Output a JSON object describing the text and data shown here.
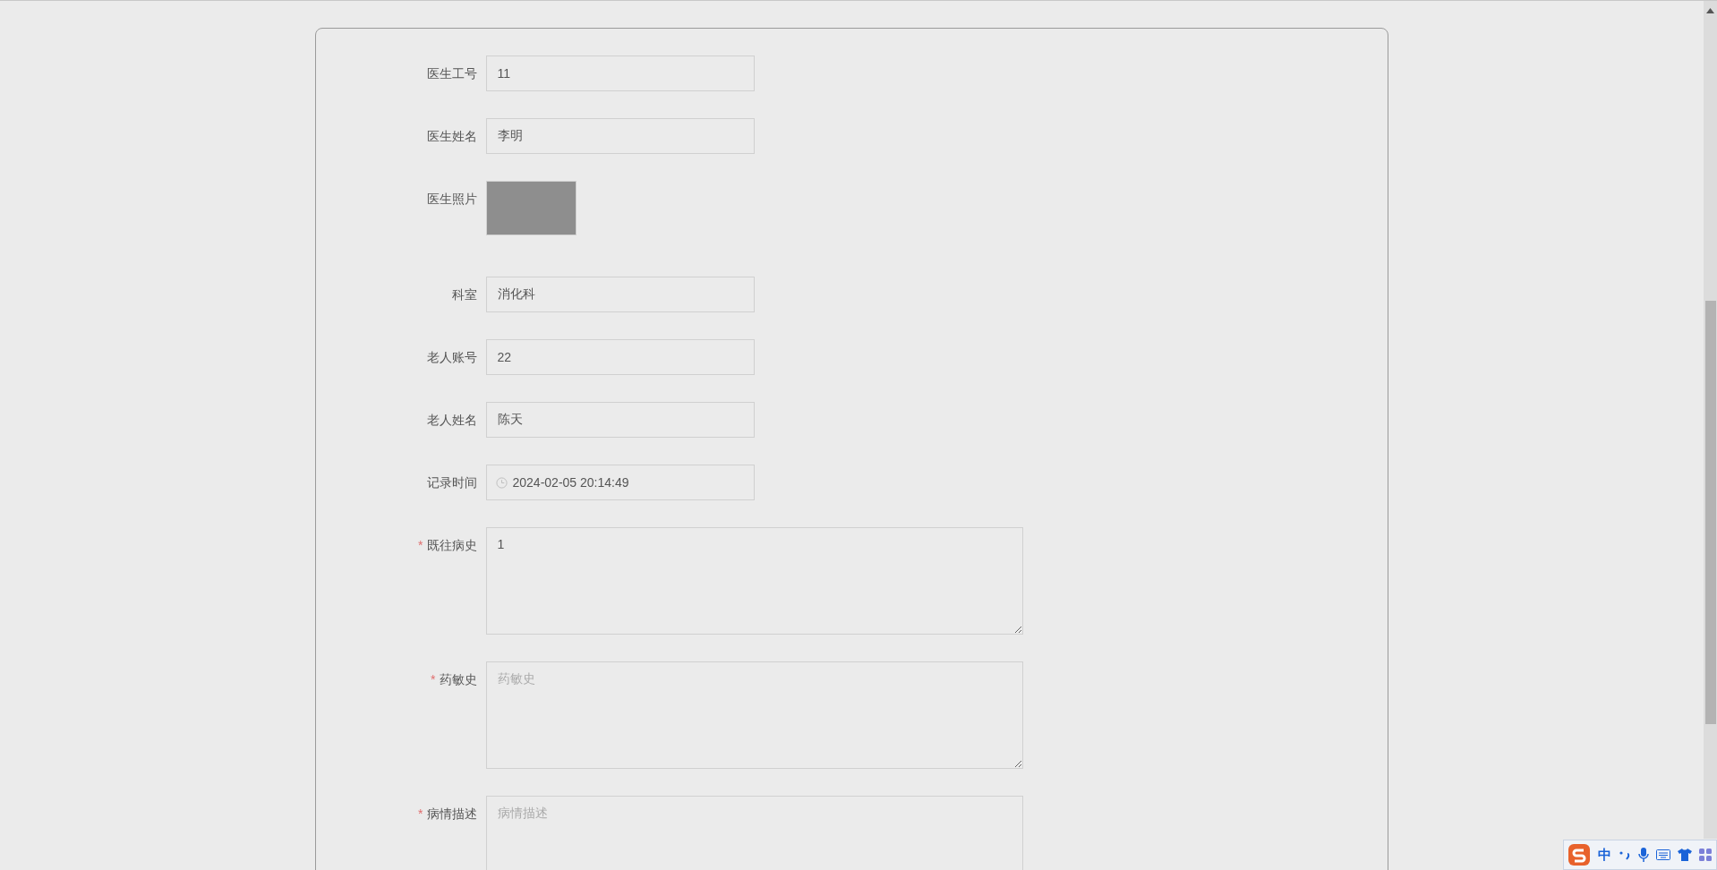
{
  "form": {
    "fields": [
      {
        "kind": "text",
        "label": "医生工号",
        "value": "11",
        "required": false
      },
      {
        "kind": "text",
        "label": "医生姓名",
        "value": "李明",
        "required": false
      },
      {
        "kind": "image",
        "label": "医生照片",
        "required": false
      },
      {
        "kind": "text",
        "label": "科室",
        "value": "消化科",
        "required": false
      },
      {
        "kind": "text",
        "label": "老人账号",
        "value": "22",
        "required": false
      },
      {
        "kind": "text",
        "label": "老人姓名",
        "value": "陈天",
        "required": false
      },
      {
        "kind": "datetime",
        "label": "记录时间",
        "value": "2024-02-05 20:14:49",
        "required": false
      },
      {
        "kind": "textarea",
        "label": "既往病史",
        "value": "1",
        "required": true
      },
      {
        "kind": "textarea",
        "label": "药敏史",
        "placeholder": "药敏史",
        "required": true
      },
      {
        "kind": "textarea",
        "label": "病情描述",
        "placeholder": "病情描述",
        "required": true
      }
    ]
  },
  "required_mark": "*",
  "ime_toolbar": {
    "mode": "中"
  }
}
